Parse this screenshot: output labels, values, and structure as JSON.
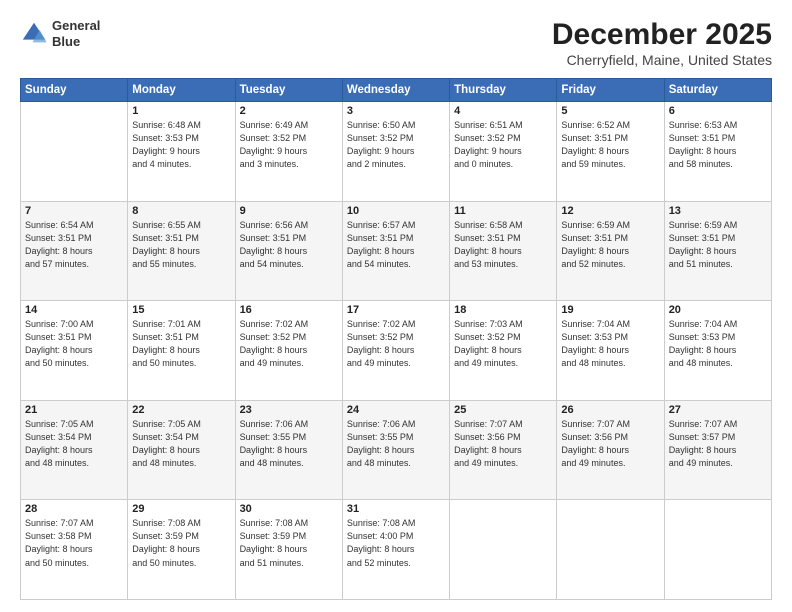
{
  "header": {
    "logo_line1": "General",
    "logo_line2": "Blue",
    "title": "December 2025",
    "subtitle": "Cherryfield, Maine, United States"
  },
  "weekdays": [
    "Sunday",
    "Monday",
    "Tuesday",
    "Wednesday",
    "Thursday",
    "Friday",
    "Saturday"
  ],
  "weeks": [
    [
      {
        "day": "",
        "info": ""
      },
      {
        "day": "1",
        "info": "Sunrise: 6:48 AM\nSunset: 3:53 PM\nDaylight: 9 hours\nand 4 minutes."
      },
      {
        "day": "2",
        "info": "Sunrise: 6:49 AM\nSunset: 3:52 PM\nDaylight: 9 hours\nand 3 minutes."
      },
      {
        "day": "3",
        "info": "Sunrise: 6:50 AM\nSunset: 3:52 PM\nDaylight: 9 hours\nand 2 minutes."
      },
      {
        "day": "4",
        "info": "Sunrise: 6:51 AM\nSunset: 3:52 PM\nDaylight: 9 hours\nand 0 minutes."
      },
      {
        "day": "5",
        "info": "Sunrise: 6:52 AM\nSunset: 3:51 PM\nDaylight: 8 hours\nand 59 minutes."
      },
      {
        "day": "6",
        "info": "Sunrise: 6:53 AM\nSunset: 3:51 PM\nDaylight: 8 hours\nand 58 minutes."
      }
    ],
    [
      {
        "day": "7",
        "info": "Sunrise: 6:54 AM\nSunset: 3:51 PM\nDaylight: 8 hours\nand 57 minutes."
      },
      {
        "day": "8",
        "info": "Sunrise: 6:55 AM\nSunset: 3:51 PM\nDaylight: 8 hours\nand 55 minutes."
      },
      {
        "day": "9",
        "info": "Sunrise: 6:56 AM\nSunset: 3:51 PM\nDaylight: 8 hours\nand 54 minutes."
      },
      {
        "day": "10",
        "info": "Sunrise: 6:57 AM\nSunset: 3:51 PM\nDaylight: 8 hours\nand 54 minutes."
      },
      {
        "day": "11",
        "info": "Sunrise: 6:58 AM\nSunset: 3:51 PM\nDaylight: 8 hours\nand 53 minutes."
      },
      {
        "day": "12",
        "info": "Sunrise: 6:59 AM\nSunset: 3:51 PM\nDaylight: 8 hours\nand 52 minutes."
      },
      {
        "day": "13",
        "info": "Sunrise: 6:59 AM\nSunset: 3:51 PM\nDaylight: 8 hours\nand 51 minutes."
      }
    ],
    [
      {
        "day": "14",
        "info": "Sunrise: 7:00 AM\nSunset: 3:51 PM\nDaylight: 8 hours\nand 50 minutes."
      },
      {
        "day": "15",
        "info": "Sunrise: 7:01 AM\nSunset: 3:51 PM\nDaylight: 8 hours\nand 50 minutes."
      },
      {
        "day": "16",
        "info": "Sunrise: 7:02 AM\nSunset: 3:52 PM\nDaylight: 8 hours\nand 49 minutes."
      },
      {
        "day": "17",
        "info": "Sunrise: 7:02 AM\nSunset: 3:52 PM\nDaylight: 8 hours\nand 49 minutes."
      },
      {
        "day": "18",
        "info": "Sunrise: 7:03 AM\nSunset: 3:52 PM\nDaylight: 8 hours\nand 49 minutes."
      },
      {
        "day": "19",
        "info": "Sunrise: 7:04 AM\nSunset: 3:53 PM\nDaylight: 8 hours\nand 48 minutes."
      },
      {
        "day": "20",
        "info": "Sunrise: 7:04 AM\nSunset: 3:53 PM\nDaylight: 8 hours\nand 48 minutes."
      }
    ],
    [
      {
        "day": "21",
        "info": "Sunrise: 7:05 AM\nSunset: 3:54 PM\nDaylight: 8 hours\nand 48 minutes."
      },
      {
        "day": "22",
        "info": "Sunrise: 7:05 AM\nSunset: 3:54 PM\nDaylight: 8 hours\nand 48 minutes."
      },
      {
        "day": "23",
        "info": "Sunrise: 7:06 AM\nSunset: 3:55 PM\nDaylight: 8 hours\nand 48 minutes."
      },
      {
        "day": "24",
        "info": "Sunrise: 7:06 AM\nSunset: 3:55 PM\nDaylight: 8 hours\nand 48 minutes."
      },
      {
        "day": "25",
        "info": "Sunrise: 7:07 AM\nSunset: 3:56 PM\nDaylight: 8 hours\nand 49 minutes."
      },
      {
        "day": "26",
        "info": "Sunrise: 7:07 AM\nSunset: 3:56 PM\nDaylight: 8 hours\nand 49 minutes."
      },
      {
        "day": "27",
        "info": "Sunrise: 7:07 AM\nSunset: 3:57 PM\nDaylight: 8 hours\nand 49 minutes."
      }
    ],
    [
      {
        "day": "28",
        "info": "Sunrise: 7:07 AM\nSunset: 3:58 PM\nDaylight: 8 hours\nand 50 minutes."
      },
      {
        "day": "29",
        "info": "Sunrise: 7:08 AM\nSunset: 3:59 PM\nDaylight: 8 hours\nand 50 minutes."
      },
      {
        "day": "30",
        "info": "Sunrise: 7:08 AM\nSunset: 3:59 PM\nDaylight: 8 hours\nand 51 minutes."
      },
      {
        "day": "31",
        "info": "Sunrise: 7:08 AM\nSunset: 4:00 PM\nDaylight: 8 hours\nand 52 minutes."
      },
      {
        "day": "",
        "info": ""
      },
      {
        "day": "",
        "info": ""
      },
      {
        "day": "",
        "info": ""
      }
    ]
  ]
}
